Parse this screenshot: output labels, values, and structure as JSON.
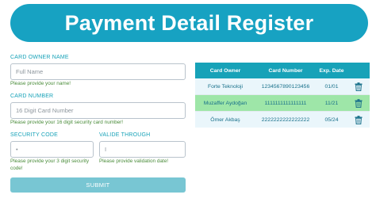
{
  "header": {
    "title": "Payment Detail Register"
  },
  "form": {
    "owner_label": "CARD OWNER NAME",
    "owner_placeholder": "Full Name",
    "owner_error": "Please provide your name!",
    "number_label": "CARD NUMBER",
    "number_placeholder": "16 Digit Card Number",
    "number_error": "Please provide your 16 digit security card number!",
    "code_label": "SECURITY CODE",
    "code_placeholder": "•",
    "code_error": "Please provide your 3 digit security code!",
    "valid_label": "VALIDE THROUGH",
    "valid_placeholder": "I",
    "valid_error": "Please provide validation date!",
    "submit_label": "SUBMIT"
  },
  "table": {
    "headers": [
      "Card Owner",
      "Card Number",
      "Exp. Date",
      ""
    ],
    "rows": [
      {
        "owner": "Forte Teknoloji",
        "number": "1234567890123456",
        "exp": "01/01"
      },
      {
        "owner": "Muzaffer Aydoğan",
        "number": "1111111111111111",
        "exp": "11/21"
      },
      {
        "owner": "Ömer Akbaş",
        "number": "2222222222222222",
        "exp": "05/24"
      }
    ]
  },
  "colors": {
    "primary": "#17a2c2",
    "selected_row": "#9ee6a8",
    "submit": "#78c6d3"
  },
  "icons": {
    "delete": "trash-icon"
  }
}
